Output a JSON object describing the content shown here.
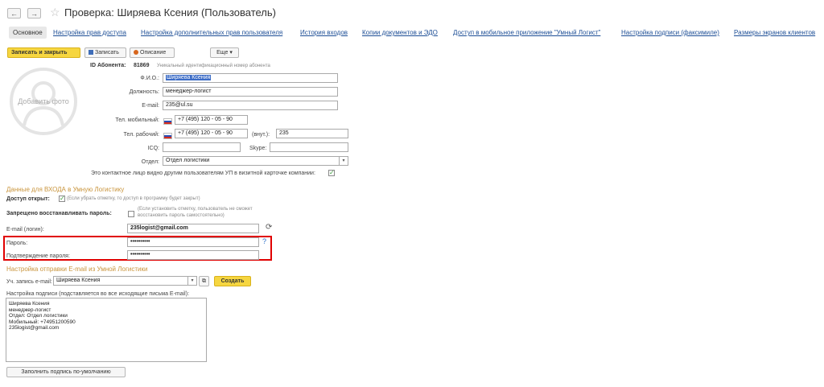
{
  "window": {
    "back": "←",
    "forward": "→",
    "star": "☆",
    "title": "Проверка: Ширяева Ксения (Пользователь)"
  },
  "tabs": [
    "Основное",
    "Настройка прав доступа",
    "Настройка дополнительных прав пользователя",
    "История входов",
    "Копии документов и ЭДО",
    "Доступ в мобильное приложение \"Умный Логист\"",
    "Настройка подписи (факсимиле)",
    "Размеры экранов клиентов"
  ],
  "toolbar": {
    "save_close": "Записать и закрыть",
    "save": "Записать",
    "description": "Описание",
    "more": "Еще ▾"
  },
  "photo": {
    "label": "Добавить фото"
  },
  "profile": {
    "id_label": "ID Абонента:",
    "id_value": "81869",
    "id_hint": "Уникальный идентификационный номер абонента",
    "fio_label": "Ф.И.О.:",
    "fio_value": "Ширяева Ксения",
    "position_label": "Должность:",
    "position_value": "менеджер-логист",
    "email_label": "E-mail:",
    "email_value": "235@ul.su",
    "mobile_label": "Тел. мобильный:",
    "mobile_value": "+7 (495) 120 - 05 - 90",
    "work_label": "Тел. рабочий:",
    "work_value": "+7 (495) 120 - 05 - 90",
    "ext_label": "(внут.):",
    "ext_value": "235",
    "icq_label": "ICQ:",
    "icq_value": "",
    "skype_label": "Skype:",
    "skype_value": "",
    "dept_label": "Отдел:",
    "dept_value": "Отдел логистики",
    "visible_label": "Это контактное лицо видно другим пользователям УП в визитной карточке компании:"
  },
  "login": {
    "header": "Данные для ВХОДА в Умную Логистику",
    "access_label": "Доступ открыт:",
    "access_hint": "(Если убрать отметку, то доступ в программу будет закрыт)",
    "restore_label": "Запрещено восстанавливать пароль:",
    "restore_hint_1": "(Если установить отметку, пользователь не сможет",
    "restore_hint_2": "восстановить пароль самостоятельно)",
    "email_label": "E-mail (логин):",
    "email_value": "235logist@gmail.com",
    "password_label": "Пароль:",
    "password_value": "••••••••••",
    "confirm_label": "Подтверждение пароля:",
    "confirm_value": "••••••••••",
    "help": "?",
    "refresh_icon": "⟳"
  },
  "mail": {
    "header": "Настройка отправки E-mail из Умной Логистики",
    "account_label": "Уч. запись e-mail:",
    "account_value": "Ширяева Ксения",
    "create": "Создать",
    "signature_label": "Настройка подписи (подставляется во все исходящие письма E-mail):",
    "signature_lines": [
      "Ширяева Ксения",
      "менеджер-логист",
      "Отдел: Отдел логистики",
      "Мобильный: +74951200590",
      "235logist@gmail.com"
    ],
    "default_button": "Заполнить подпись по-умолчанию"
  },
  "colors": {
    "accent": "#f6d640",
    "link": "#1d4e96",
    "highlight": "#e00000",
    "section": "#c9953d"
  }
}
